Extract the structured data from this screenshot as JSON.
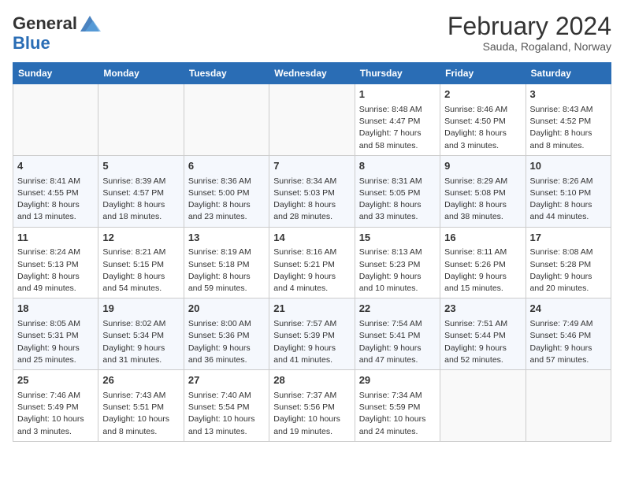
{
  "logo": {
    "general": "General",
    "blue": "Blue"
  },
  "title": "February 2024",
  "subtitle": "Sauda, Rogaland, Norway",
  "days_of_week": [
    "Sunday",
    "Monday",
    "Tuesday",
    "Wednesday",
    "Thursday",
    "Friday",
    "Saturday"
  ],
  "weeks": [
    [
      {
        "day": "",
        "info": ""
      },
      {
        "day": "",
        "info": ""
      },
      {
        "day": "",
        "info": ""
      },
      {
        "day": "",
        "info": ""
      },
      {
        "day": "1",
        "info": "Sunrise: 8:48 AM\nSunset: 4:47 PM\nDaylight: 7 hours\nand 58 minutes."
      },
      {
        "day": "2",
        "info": "Sunrise: 8:46 AM\nSunset: 4:50 PM\nDaylight: 8 hours\nand 3 minutes."
      },
      {
        "day": "3",
        "info": "Sunrise: 8:43 AM\nSunset: 4:52 PM\nDaylight: 8 hours\nand 8 minutes."
      }
    ],
    [
      {
        "day": "4",
        "info": "Sunrise: 8:41 AM\nSunset: 4:55 PM\nDaylight: 8 hours\nand 13 minutes."
      },
      {
        "day": "5",
        "info": "Sunrise: 8:39 AM\nSunset: 4:57 PM\nDaylight: 8 hours\nand 18 minutes."
      },
      {
        "day": "6",
        "info": "Sunrise: 8:36 AM\nSunset: 5:00 PM\nDaylight: 8 hours\nand 23 minutes."
      },
      {
        "day": "7",
        "info": "Sunrise: 8:34 AM\nSunset: 5:03 PM\nDaylight: 8 hours\nand 28 minutes."
      },
      {
        "day": "8",
        "info": "Sunrise: 8:31 AM\nSunset: 5:05 PM\nDaylight: 8 hours\nand 33 minutes."
      },
      {
        "day": "9",
        "info": "Sunrise: 8:29 AM\nSunset: 5:08 PM\nDaylight: 8 hours\nand 38 minutes."
      },
      {
        "day": "10",
        "info": "Sunrise: 8:26 AM\nSunset: 5:10 PM\nDaylight: 8 hours\nand 44 minutes."
      }
    ],
    [
      {
        "day": "11",
        "info": "Sunrise: 8:24 AM\nSunset: 5:13 PM\nDaylight: 8 hours\nand 49 minutes."
      },
      {
        "day": "12",
        "info": "Sunrise: 8:21 AM\nSunset: 5:15 PM\nDaylight: 8 hours\nand 54 minutes."
      },
      {
        "day": "13",
        "info": "Sunrise: 8:19 AM\nSunset: 5:18 PM\nDaylight: 8 hours\nand 59 minutes."
      },
      {
        "day": "14",
        "info": "Sunrise: 8:16 AM\nSunset: 5:21 PM\nDaylight: 9 hours\nand 4 minutes."
      },
      {
        "day": "15",
        "info": "Sunrise: 8:13 AM\nSunset: 5:23 PM\nDaylight: 9 hours\nand 10 minutes."
      },
      {
        "day": "16",
        "info": "Sunrise: 8:11 AM\nSunset: 5:26 PM\nDaylight: 9 hours\nand 15 minutes."
      },
      {
        "day": "17",
        "info": "Sunrise: 8:08 AM\nSunset: 5:28 PM\nDaylight: 9 hours\nand 20 minutes."
      }
    ],
    [
      {
        "day": "18",
        "info": "Sunrise: 8:05 AM\nSunset: 5:31 PM\nDaylight: 9 hours\nand 25 minutes."
      },
      {
        "day": "19",
        "info": "Sunrise: 8:02 AM\nSunset: 5:34 PM\nDaylight: 9 hours\nand 31 minutes."
      },
      {
        "day": "20",
        "info": "Sunrise: 8:00 AM\nSunset: 5:36 PM\nDaylight: 9 hours\nand 36 minutes."
      },
      {
        "day": "21",
        "info": "Sunrise: 7:57 AM\nSunset: 5:39 PM\nDaylight: 9 hours\nand 41 minutes."
      },
      {
        "day": "22",
        "info": "Sunrise: 7:54 AM\nSunset: 5:41 PM\nDaylight: 9 hours\nand 47 minutes."
      },
      {
        "day": "23",
        "info": "Sunrise: 7:51 AM\nSunset: 5:44 PM\nDaylight: 9 hours\nand 52 minutes."
      },
      {
        "day": "24",
        "info": "Sunrise: 7:49 AM\nSunset: 5:46 PM\nDaylight: 9 hours\nand 57 minutes."
      }
    ],
    [
      {
        "day": "25",
        "info": "Sunrise: 7:46 AM\nSunset: 5:49 PM\nDaylight: 10 hours\nand 3 minutes."
      },
      {
        "day": "26",
        "info": "Sunrise: 7:43 AM\nSunset: 5:51 PM\nDaylight: 10 hours\nand 8 minutes."
      },
      {
        "day": "27",
        "info": "Sunrise: 7:40 AM\nSunset: 5:54 PM\nDaylight: 10 hours\nand 13 minutes."
      },
      {
        "day": "28",
        "info": "Sunrise: 7:37 AM\nSunset: 5:56 PM\nDaylight: 10 hours\nand 19 minutes."
      },
      {
        "day": "29",
        "info": "Sunrise: 7:34 AM\nSunset: 5:59 PM\nDaylight: 10 hours\nand 24 minutes."
      },
      {
        "day": "",
        "info": ""
      },
      {
        "day": "",
        "info": ""
      }
    ]
  ]
}
